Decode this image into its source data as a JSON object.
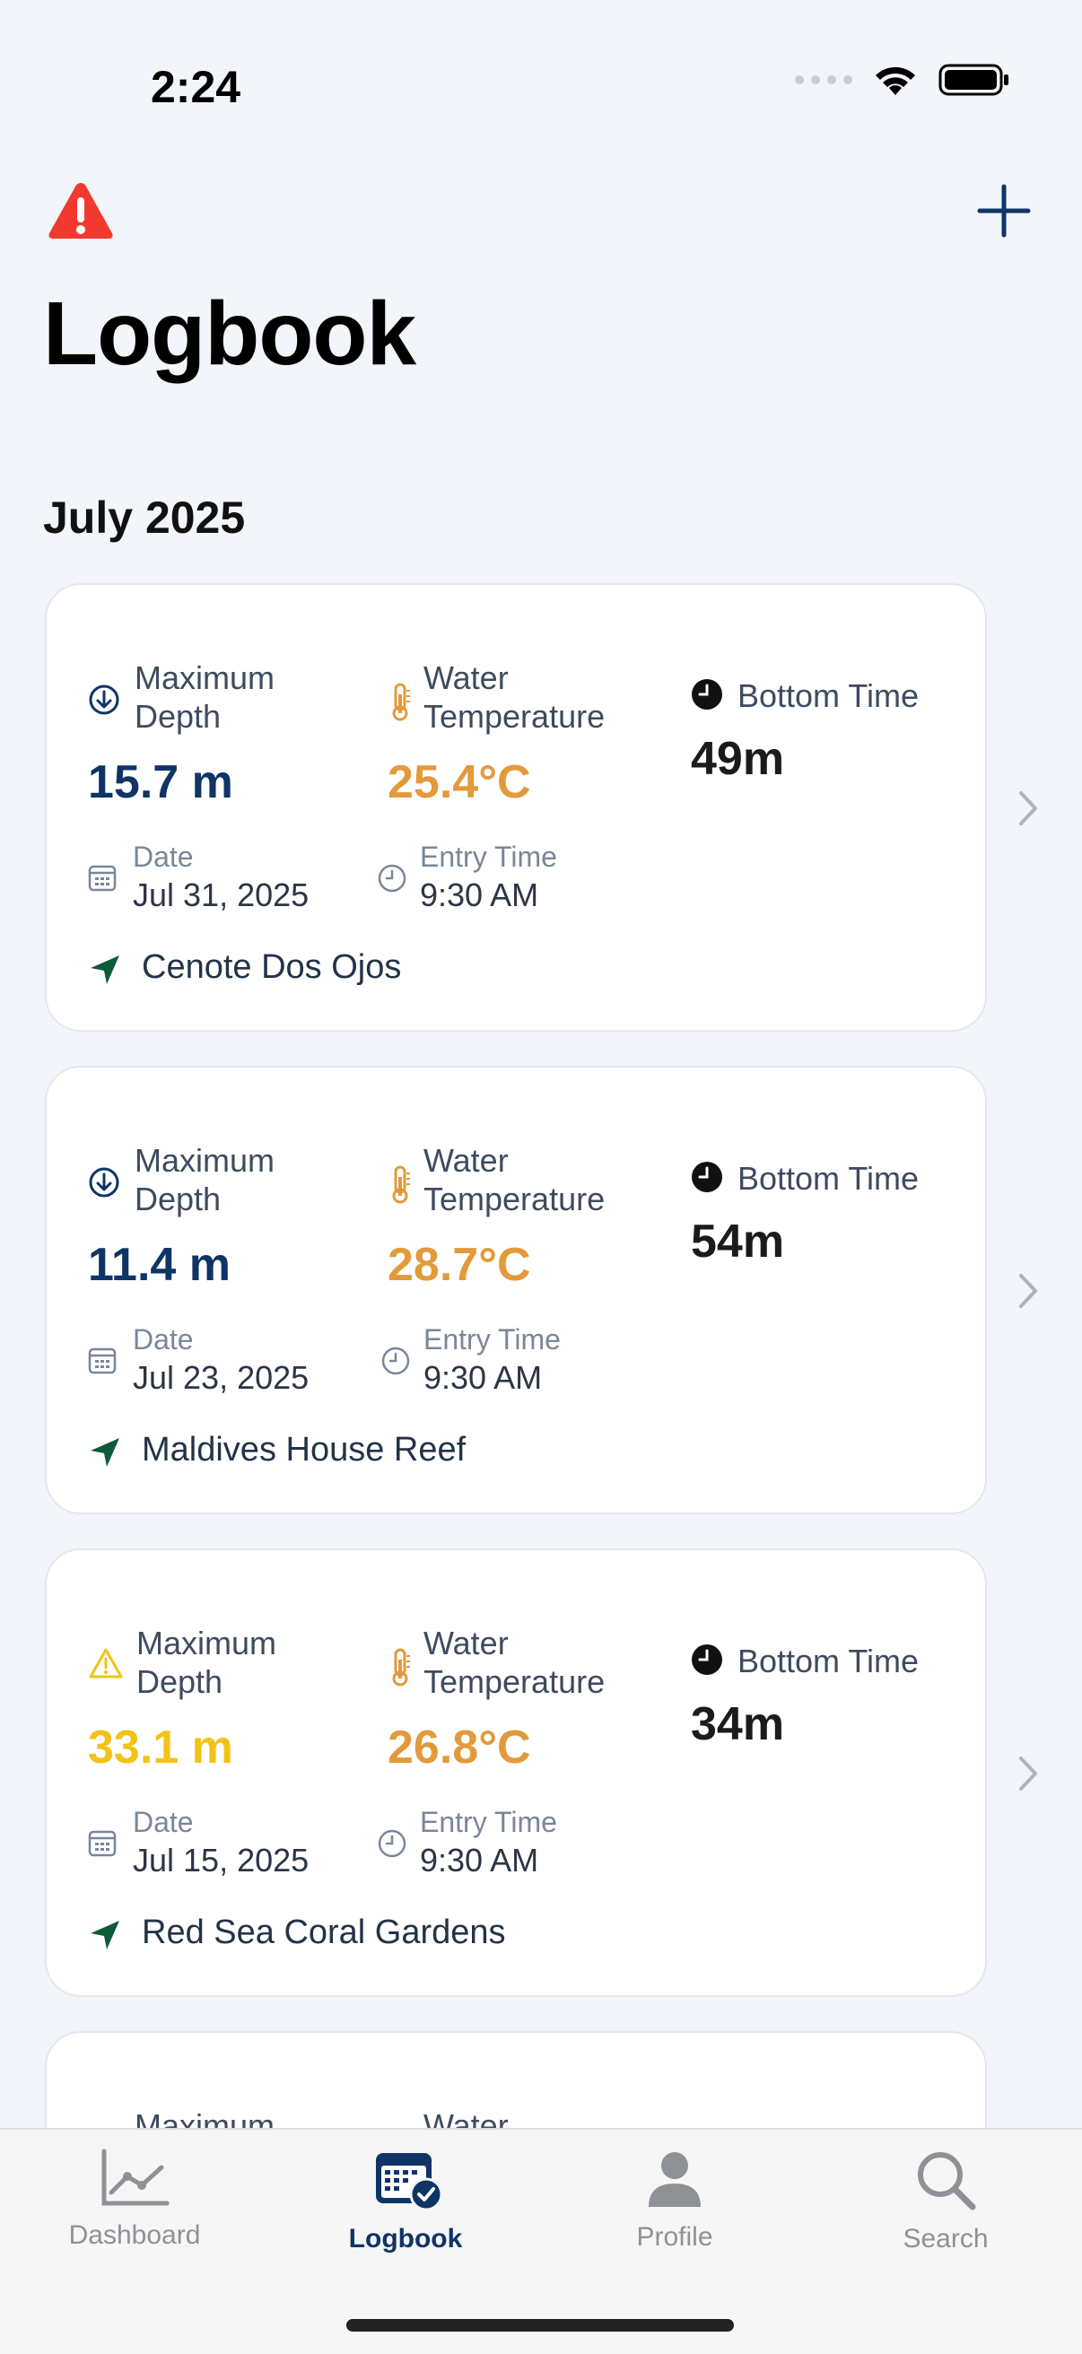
{
  "status_bar": {
    "time": "2:24"
  },
  "header": {
    "title": "Logbook",
    "add_icon": "plus-icon",
    "alert_icon": "warning-triangle-icon"
  },
  "section": {
    "title": "July 2025"
  },
  "labels": {
    "max_depth_line1": "Maximum",
    "max_depth_line2": "Depth",
    "water_temp_line1": "Water",
    "water_temp_line2": "Temperature",
    "bottom_time": "Bottom Time",
    "date": "Date",
    "entry_time": "Entry Time"
  },
  "dives": [
    {
      "max_depth": "15.7 m",
      "depth_status": "normal",
      "water_temp": "25.4°C",
      "bottom_time": "49m",
      "date": "Jul 31, 2025",
      "entry_time": "9:30 AM",
      "location": "Cenote Dos Ojos"
    },
    {
      "max_depth": "11.4 m",
      "depth_status": "normal",
      "water_temp": "28.7°C",
      "bottom_time": "54m",
      "date": "Jul 23, 2025",
      "entry_time": "9:30 AM",
      "location": "Maldives House Reef"
    },
    {
      "max_depth": "33.1 m",
      "depth_status": "warning",
      "water_temp": "26.8°C",
      "bottom_time": "34m",
      "date": "Jul 15, 2025",
      "entry_time": "9:30 AM",
      "location": "Red Sea Coral Gardens"
    }
  ],
  "tabs": [
    {
      "label": "Dashboard",
      "icon": "chart-icon",
      "active": false
    },
    {
      "label": "Logbook",
      "icon": "calendar-check-icon",
      "active": true
    },
    {
      "label": "Profile",
      "icon": "person-icon",
      "active": false
    },
    {
      "label": "Search",
      "icon": "search-icon",
      "active": false
    }
  ],
  "colors": {
    "accent": "#0f3466",
    "temperature": "#e39a3b",
    "warning": "#f2c316",
    "alert": "#f2392f",
    "location": "#0e5b3a"
  }
}
